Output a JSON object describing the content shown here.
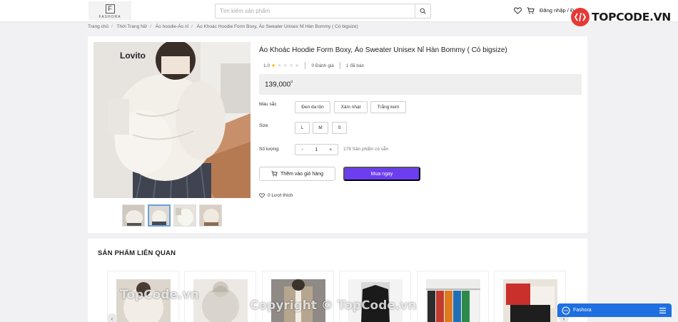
{
  "header": {
    "logo_letter": "F",
    "logo_text": "FASHORA",
    "search_placeholder": "Tìm kiếm sản phẩm",
    "login_text": "Đăng nhập / Đ"
  },
  "watermark_brand": {
    "text": "TOPCODE.VN",
    "badge_color": "#e53935"
  },
  "breadcrumb": [
    "Trang chủ",
    "Thời Trang Nữ",
    "Áo hoodie-Áo nỉ",
    "Áo Khoác Hoodie Form Boxy, Áo Sweater Unisex Nỉ Hàn Bommy ( Có bigsize)"
  ],
  "product": {
    "title": "Áo Khoác Hoodie Form Boxy, Áo Sweater Unisex Nỉ Hàn Bommy ( Có bigsize)",
    "rating": "1.0",
    "rating_stars": 1,
    "reviews": "0 Đánh giá",
    "sold": "1 đã bán",
    "price": "139,000",
    "currency": "₫",
    "image_brand_text": "Lovito",
    "color_label": "Màu sắc",
    "colors": [
      "Đen da lộn",
      "Xám nhạt",
      "Trắng kem"
    ],
    "size_label": "Size",
    "sizes": [
      "L",
      "M",
      "S"
    ],
    "qty_label": "Số lượng:",
    "qty_minus": "-",
    "qty_value": "1",
    "qty_plus": "+",
    "stock": "179 Sản phẩm có sẵn",
    "add_to_cart": "Thêm vào giỏ hàng",
    "buy_now": "Mua ngay",
    "likes": "0 Lượt thích",
    "accent_color": "#6c3ef0"
  },
  "related": {
    "title": "SẢN PHẨM LIÊN QUAN",
    "prev": "‹",
    "next": "›"
  },
  "watermarks": {
    "left": "TopCode.vn",
    "center": "Copyright © TopCode.vn"
  },
  "chat": {
    "label": "Fashora"
  }
}
